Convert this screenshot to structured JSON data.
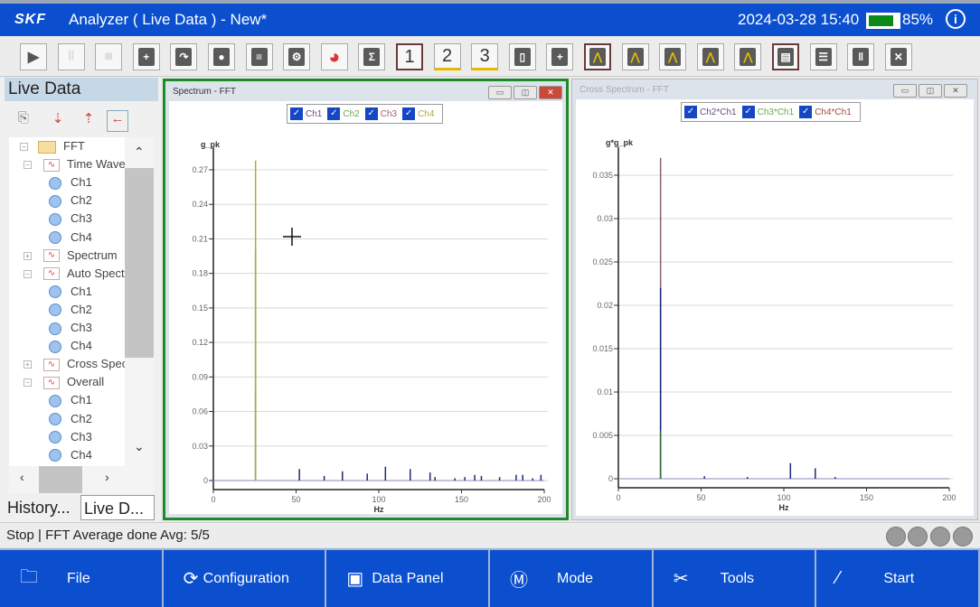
{
  "titlebar": {
    "logo": "SKF",
    "title": "Analyzer ( Live Data ) - New*",
    "datetime": "2024-03-28 15:40",
    "battery_level": 85,
    "battery_text": "85%",
    "info": "i"
  },
  "toolbar": {
    "buttons": [
      {
        "name": "play",
        "glyph": "▶"
      },
      {
        "name": "pause",
        "glyph": "‖"
      },
      {
        "name": "stop",
        "glyph": "■"
      },
      {
        "name": "new",
        "glyph": "+"
      },
      {
        "name": "open",
        "glyph": "↷"
      },
      {
        "name": "save",
        "glyph": "●"
      },
      {
        "name": "export",
        "glyph": "≡"
      },
      {
        "name": "settings",
        "glyph": "⚙"
      },
      {
        "name": "pie-chart",
        "glyph": "◕"
      },
      {
        "name": "sigma",
        "glyph": "Σ"
      },
      {
        "name": "layout-1",
        "glyph": "1"
      },
      {
        "name": "layout-2",
        "glyph": "2"
      },
      {
        "name": "layout-3",
        "glyph": "3"
      },
      {
        "name": "device",
        "glyph": "▯"
      },
      {
        "name": "add-cursor",
        "glyph": "+"
      },
      {
        "name": "single-cursor",
        "glyph": "⋀"
      },
      {
        "name": "harmonic-cursor",
        "glyph": "⋀"
      },
      {
        "name": "sideband-cursor",
        "glyph": "⋀"
      },
      {
        "name": "band-cursor",
        "glyph": "⋀"
      },
      {
        "name": "peak-cursor",
        "glyph": "⋀"
      },
      {
        "name": "notes",
        "glyph": "▤"
      },
      {
        "name": "split-horizontal",
        "glyph": "☰"
      },
      {
        "name": "split-vertical",
        "glyph": "‖"
      },
      {
        "name": "close-all",
        "glyph": "✕"
      }
    ]
  },
  "left": {
    "title": "Live Data",
    "tree": [
      {
        "label": "FFT",
        "type": "folder",
        "level": 0
      },
      {
        "label": "Time Wave",
        "type": "wave",
        "level": 1
      },
      {
        "label": "Ch1",
        "type": "ch",
        "level": 2
      },
      {
        "label": "Ch2",
        "type": "ch",
        "level": 2
      },
      {
        "label": "Ch3",
        "type": "ch",
        "level": 2
      },
      {
        "label": "Ch4",
        "type": "ch",
        "level": 2
      },
      {
        "label": "Spectrum",
        "type": "wave",
        "level": 1
      },
      {
        "label": "Auto Spect",
        "type": "wave",
        "level": 1
      },
      {
        "label": "Ch1",
        "type": "ch",
        "level": 2
      },
      {
        "label": "Ch2",
        "type": "ch",
        "level": 2
      },
      {
        "label": "Ch3",
        "type": "ch",
        "level": 2
      },
      {
        "label": "Ch4",
        "type": "ch",
        "level": 2
      },
      {
        "label": "Cross Spec",
        "type": "wave",
        "level": 1
      },
      {
        "label": "Overall",
        "type": "wave",
        "level": 1
      },
      {
        "label": "Ch1",
        "type": "ch",
        "level": 2
      },
      {
        "label": "Ch2",
        "type": "ch",
        "level": 2
      },
      {
        "label": "Ch3",
        "type": "ch",
        "level": 2
      },
      {
        "label": "Ch4",
        "type": "ch",
        "level": 2
      }
    ],
    "tabs": [
      "History...",
      "Live D..."
    ]
  },
  "windows": [
    {
      "title": "Spectrum - FFT",
      "active": true,
      "legend": [
        {
          "label": "Ch1",
          "color": "#6b4c7a"
        },
        {
          "label": "Ch2",
          "color": "#6aa84f"
        },
        {
          "label": "Ch3",
          "color": "#a0606a"
        },
        {
          "label": "Ch4",
          "color": "#b5a642"
        }
      ]
    },
    {
      "title": "Cross Spectrum - FFT",
      "active": false,
      "legend": [
        {
          "label": "Ch2*Ch1",
          "color": "#6b4c7a"
        },
        {
          "label": "Ch3*Ch1",
          "color": "#6aa84f"
        },
        {
          "label": "Ch4*Ch1",
          "color": "#a04a3a"
        }
      ]
    }
  ],
  "chart_data": [
    {
      "type": "line",
      "ylabel": "g_pk",
      "xlabel": "Hz",
      "xlim": [
        0,
        200
      ],
      "ylim": [
        0,
        0.28
      ],
      "xticks": [
        0,
        50,
        100,
        150,
        200
      ],
      "yticks": [
        0,
        0.03,
        0.06,
        0.09,
        0.12,
        0.15,
        0.18,
        0.21,
        0.24,
        0.27
      ],
      "grid": true,
      "series": [
        {
          "name": "Ch1",
          "color": "#1c2a7a",
          "peaks": [
            [
              25.5,
              0.078
            ],
            [
              52,
              0.01
            ],
            [
              67,
              0.004
            ],
            [
              78,
              0.008
            ],
            [
              93,
              0.006
            ],
            [
              104,
              0.012
            ],
            [
              119,
              0.01
            ],
            [
              131,
              0.007
            ],
            [
              134,
              0.003
            ],
            [
              146,
              0.002
            ],
            [
              152,
              0.003
            ],
            [
              158,
              0.005
            ],
            [
              162,
              0.004
            ],
            [
              173,
              0.003
            ],
            [
              183,
              0.005
            ],
            [
              187,
              0.005
            ],
            [
              193,
              0.002
            ],
            [
              198,
              0.005
            ]
          ]
        },
        {
          "name": "Ch2",
          "color": "#4a9a3a",
          "peaks": [
            [
              25.5,
              0.2
            ]
          ]
        },
        {
          "name": "Ch3",
          "color": "#a8a8d0",
          "peaks": [
            [
              25.5,
              0.03
            ]
          ]
        },
        {
          "name": "Ch4",
          "color": "#b5a642",
          "peaks": [
            [
              25.5,
              0.278
            ]
          ]
        }
      ]
    },
    {
      "type": "line",
      "ylabel": "g*g_pk",
      "xlabel": "Hz",
      "xlim": [
        0,
        200
      ],
      "ylim": [
        0,
        0.037
      ],
      "xticks": [
        0,
        50,
        100,
        150,
        200
      ],
      "yticks": [
        0,
        0.005,
        0.01,
        0.015,
        0.02,
        0.025,
        0.03,
        0.035
      ],
      "grid": true,
      "series": [
        {
          "name": "Ch4*Ch1",
          "color": "#8a6070",
          "peaks": [
            [
              25.5,
              0.037
            ]
          ]
        },
        {
          "name": "Ch2*Ch1",
          "color": "#1c2a7a",
          "peaks": [
            [
              25.5,
              0.022
            ],
            [
              52,
              0.0003
            ],
            [
              78,
              0.0002
            ],
            [
              104,
              0.0018
            ],
            [
              119,
              0.0012
            ],
            [
              131,
              0.0002
            ]
          ]
        },
        {
          "name": "Ch3*Ch1",
          "color": "#3a6a3a",
          "peaks": [
            [
              25.5,
              0.0055
            ]
          ]
        }
      ]
    }
  ],
  "status": {
    "text": "Stop  | FFT Average done Avg: 5/5"
  },
  "nav": [
    {
      "label": "File",
      "icon": "folder",
      "glyph": "🗀"
    },
    {
      "label": "Configuration",
      "icon": "config",
      "glyph": "⟳"
    },
    {
      "label": "Data Panel",
      "icon": "data-panel",
      "glyph": "▣"
    },
    {
      "label": "Mode",
      "icon": "mode",
      "glyph": "Ⓜ"
    },
    {
      "label": "Tools",
      "icon": "tools",
      "glyph": "✂"
    },
    {
      "label": "Start",
      "icon": "start",
      "glyph": "⁄"
    }
  ]
}
